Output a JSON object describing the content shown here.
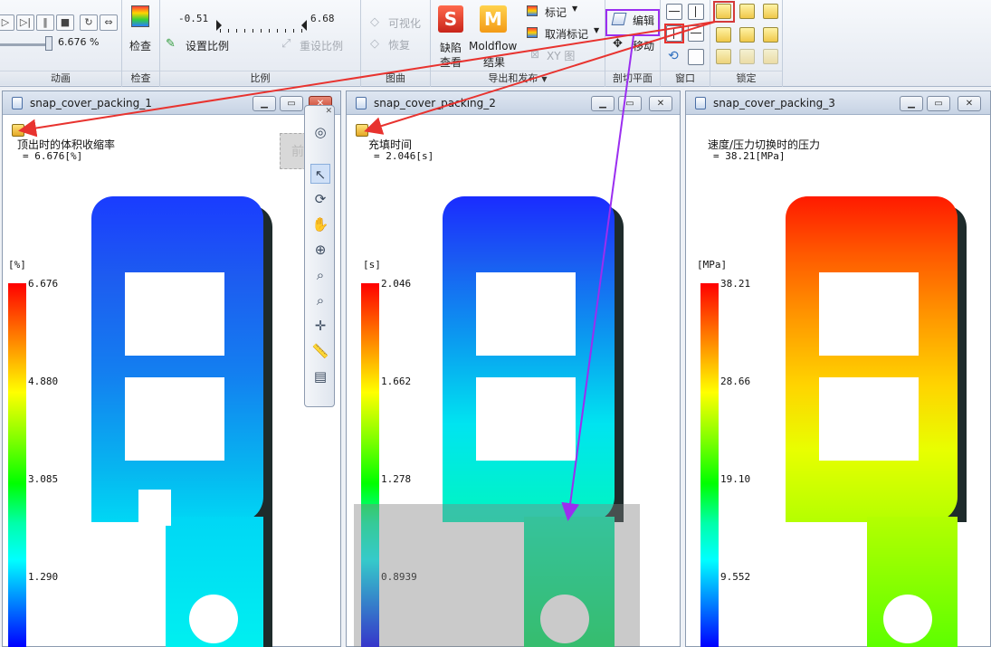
{
  "ribbon": {
    "animation": {
      "label": "动画",
      "percent": "6.676 %",
      "buttons": [
        "play-button",
        "step-forward-button",
        "stop-button",
        "loop-button",
        "swap-button"
      ]
    },
    "inspect": {
      "label": "检查",
      "button_label": "检查"
    },
    "scale": {
      "label": "比例",
      "min": "-0.51",
      "max": "6.68",
      "set_scale": "设置比例",
      "reset_scale": "重设比例"
    },
    "curve": {
      "label": "图曲",
      "visualize": "可视化",
      "restore": "恢复"
    },
    "export": {
      "label": "导出和发布",
      "defect_btn_line1": "缺陷",
      "defect_btn_line2": "查看",
      "moldflow_btn_line1": "Moldflow",
      "moldflow_btn_line2": "结果",
      "mark": "标记",
      "unmark": "取消标记",
      "xy_plot": "XY 图"
    },
    "cut_plane": {
      "label": "剖切平面",
      "edit": "编辑",
      "move": "移动"
    },
    "window": {
      "label": "窗口"
    },
    "lock": {
      "label": "锁定"
    }
  },
  "viewports": [
    {
      "title": "snap_cover_packing_1",
      "result_name": "顶出时的体积收缩率",
      "result_value": "= 6.676[%]",
      "unit": "[%]",
      "ticks": [
        "6.676",
        "4.880",
        "3.085",
        "1.290"
      ]
    },
    {
      "title": "snap_cover_packing_2",
      "result_name": "充填时间",
      "result_value": "= 2.046[s]",
      "unit": "[s]",
      "ticks": [
        "2.046",
        "1.662",
        "1.278",
        "0.8939"
      ]
    },
    {
      "title": "snap_cover_packing_3",
      "result_name": "速度/压力切换时的压力",
      "result_value": "= 38.21[MPa]",
      "unit": "[MPa]",
      "ticks": [
        "38.21",
        "28.66",
        "19.10",
        "9.552"
      ]
    }
  ],
  "colors": {
    "annotation_red": "#e8332f",
    "annotation_purple": "#9b2ef0"
  }
}
